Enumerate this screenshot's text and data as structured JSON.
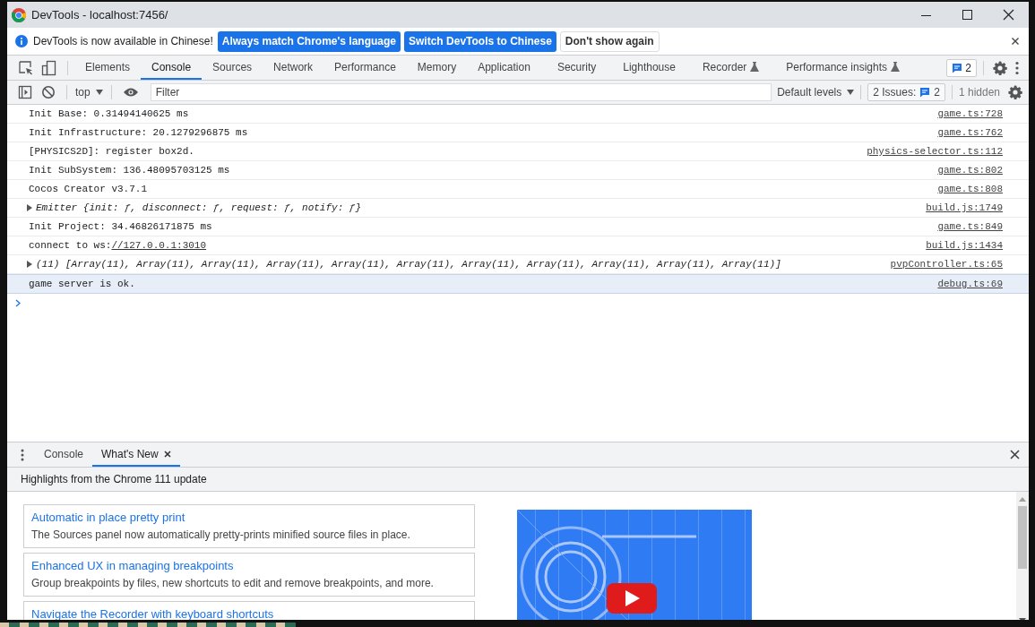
{
  "window": {
    "title": "DevTools - localhost:7456/"
  },
  "infobar": {
    "message": "DevTools is now available in Chinese!",
    "buttons": [
      {
        "label": "Always match Chrome's language",
        "kind": "primary"
      },
      {
        "label": "Switch DevTools to Chinese",
        "kind": "primary"
      },
      {
        "label": "Don't show again",
        "kind": "secondary"
      }
    ]
  },
  "tabs": [
    {
      "label": "Elements",
      "selected": false,
      "experimental": false
    },
    {
      "label": "Console",
      "selected": true,
      "experimental": false
    },
    {
      "label": "Sources",
      "selected": false,
      "experimental": false
    },
    {
      "label": "Network",
      "selected": false,
      "experimental": false
    },
    {
      "label": "Performance",
      "selected": false,
      "experimental": false
    },
    {
      "label": "Memory",
      "selected": false,
      "experimental": false
    },
    {
      "label": "Application",
      "selected": false,
      "experimental": false
    },
    {
      "label": "Security",
      "selected": false,
      "experimental": false
    },
    {
      "label": "Lighthouse",
      "selected": false,
      "experimental": false
    },
    {
      "label": "Recorder",
      "selected": false,
      "experimental": true
    },
    {
      "label": "Performance insights",
      "selected": false,
      "experimental": true
    }
  ],
  "issues_badge": "2",
  "console_toolbar": {
    "context": "top",
    "filter_placeholder": "Filter",
    "levels": "Default levels",
    "issues_label": "2 Issues:",
    "issues_count": "2",
    "hidden": "1 hidden"
  },
  "messages": [
    {
      "kind": "plain",
      "text": "Init Base: 0.31494140625 ms",
      "source": "game.ts:728",
      "highlighted": false
    },
    {
      "kind": "plain",
      "text": "Init Infrastructure: 20.1279296875 ms",
      "source": "game.ts:762",
      "highlighted": false
    },
    {
      "kind": "plain",
      "text": "[PHYSICS2D]: register box2d.",
      "source": "physics-selector.ts:112",
      "highlighted": false
    },
    {
      "kind": "plain",
      "text": "Init SubSystem: 136.48095703125 ms",
      "source": "game.ts:802",
      "highlighted": false
    },
    {
      "kind": "plain",
      "text": "Cocos Creator v3.7.1",
      "source": "game.ts:808",
      "highlighted": false
    },
    {
      "kind": "object",
      "text": "Emitter {init: ƒ, disconnect: ƒ, request: ƒ, notify: ƒ}",
      "source": "build.js:1749",
      "highlighted": false
    },
    {
      "kind": "plain",
      "text": "Init Project: 34.46826171875 ms",
      "source": "game.ts:849",
      "highlighted": false
    },
    {
      "kind": "link",
      "text": "connect to ws:",
      "link": "//127.0.0.1:3010",
      "source": "build.js:1434",
      "highlighted": false
    },
    {
      "kind": "object",
      "text": "(11) [Array(11), Array(11), Array(11), Array(11), Array(11), Array(11), Array(11), Array(11), Array(11), Array(11), Array(11)]",
      "source": "pvpController.ts:65",
      "highlighted": false
    },
    {
      "kind": "plain",
      "text": "game server is ok.",
      "source": "debug.ts:69",
      "highlighted": true
    }
  ],
  "drawer": {
    "tabs": [
      {
        "label": "Console",
        "selected": false,
        "closable": false
      },
      {
        "label": "What's New",
        "selected": true,
        "closable": true
      }
    ],
    "header": "Highlights from the Chrome 111 update",
    "cards": [
      {
        "title": "Automatic in place pretty print",
        "description": "The Sources panel now automatically pretty-prints minified source files in place."
      },
      {
        "title": "Enhanced UX in managing breakpoints",
        "description": "Group breakpoints by files, new shortcuts to edit and remove breakpoints, and more."
      },
      {
        "title": "Navigate the Recorder with keyboard shortcuts"
      }
    ]
  }
}
